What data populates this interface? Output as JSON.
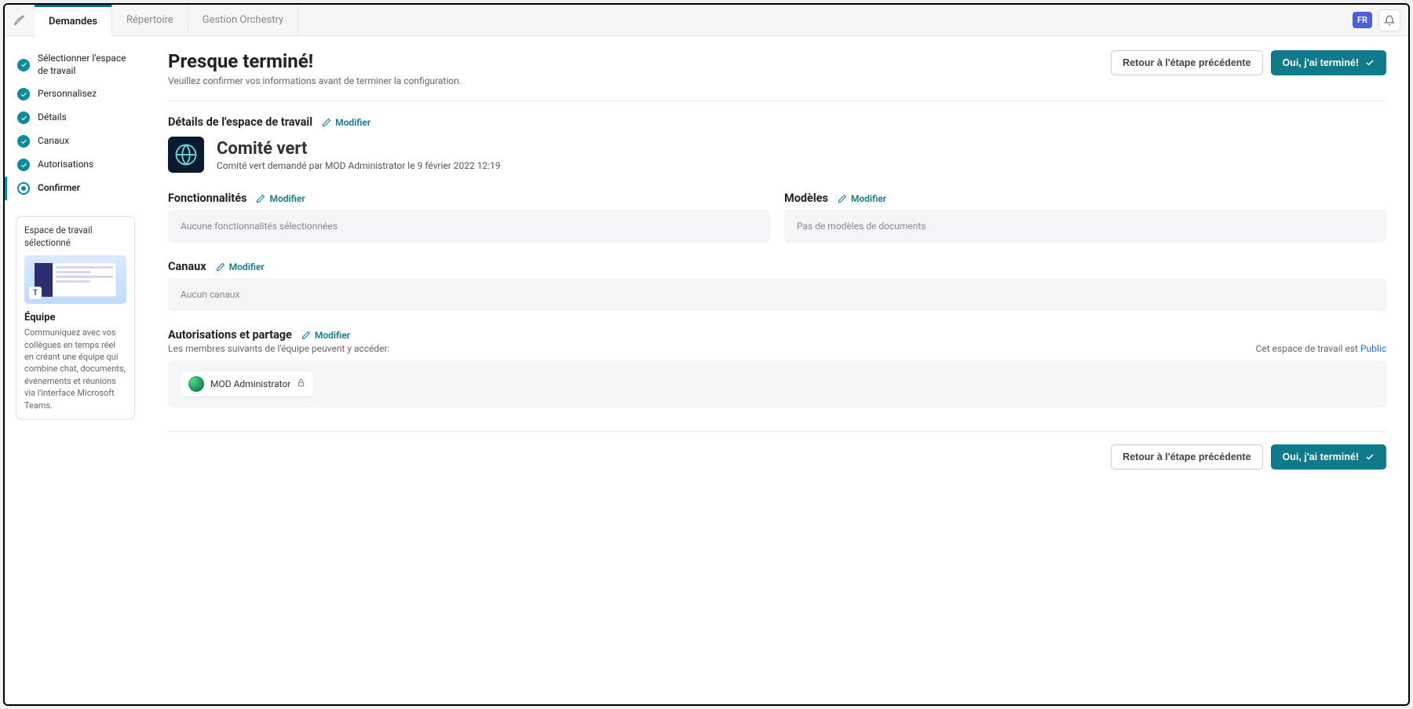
{
  "topbar": {
    "tabs": [
      {
        "label": "Demandes"
      },
      {
        "label": "Répertoire"
      },
      {
        "label": "Gestion Orchestry"
      }
    ],
    "language": "FR"
  },
  "steps": [
    {
      "label": "Sélectionner l'espace de travail",
      "status": "done"
    },
    {
      "label": "Personnalisez",
      "status": "done"
    },
    {
      "label": "Détails",
      "status": "done"
    },
    {
      "label": "Canaux",
      "status": "done"
    },
    {
      "label": "Autorisations",
      "status": "done"
    },
    {
      "label": "Confirmer",
      "status": "current"
    }
  ],
  "selectedWorkspaceCard": {
    "heading": "Espace de travail sélectionné",
    "title": "Équipe",
    "description": "Communiquez avec vos collègues en temps réel en créant une équipe qui combine chat, documents, événements et réunions via l'interface Microsoft Teams."
  },
  "header": {
    "title": "Presque terminé!",
    "subtitle": "Veuillez confirmer vos informations avant de terminer la configuration.",
    "backLabel": "Retour à l'étape précédente",
    "doneLabel": "Oui, j'ai terminé!"
  },
  "details": {
    "sectionTitle": "Détails de l'espace de travail",
    "modifyLabel": "Modifier",
    "workspaceName": "Comité vert",
    "requestedBy": "Comité vert demandé par MOD Administrator le 9 février 2022 12:19"
  },
  "features": {
    "sectionTitle": "Fonctionnalités",
    "modifyLabel": "Modifier",
    "emptyText": "Aucune fonctionnalités sélectionnées"
  },
  "models": {
    "sectionTitle": "Modèles",
    "modifyLabel": "Modifier",
    "emptyText": "Pas de modèles de documents"
  },
  "channels": {
    "sectionTitle": "Canaux",
    "modifyLabel": "Modifier",
    "emptyText": "Aucun canaux"
  },
  "permissions": {
    "sectionTitle": "Autorisations et partage",
    "modifyLabel": "Modifier",
    "subtitle": "Les membres suivants de l'équipe peuvent y accéder:",
    "privacyPrefix": "Cet espace de travail est ",
    "privacyValue": "Public",
    "members": [
      {
        "name": "MOD Administrator"
      }
    ]
  },
  "footer": {
    "backLabel": "Retour à l'étape précédente",
    "doneLabel": "Oui, j'ai terminé!"
  }
}
